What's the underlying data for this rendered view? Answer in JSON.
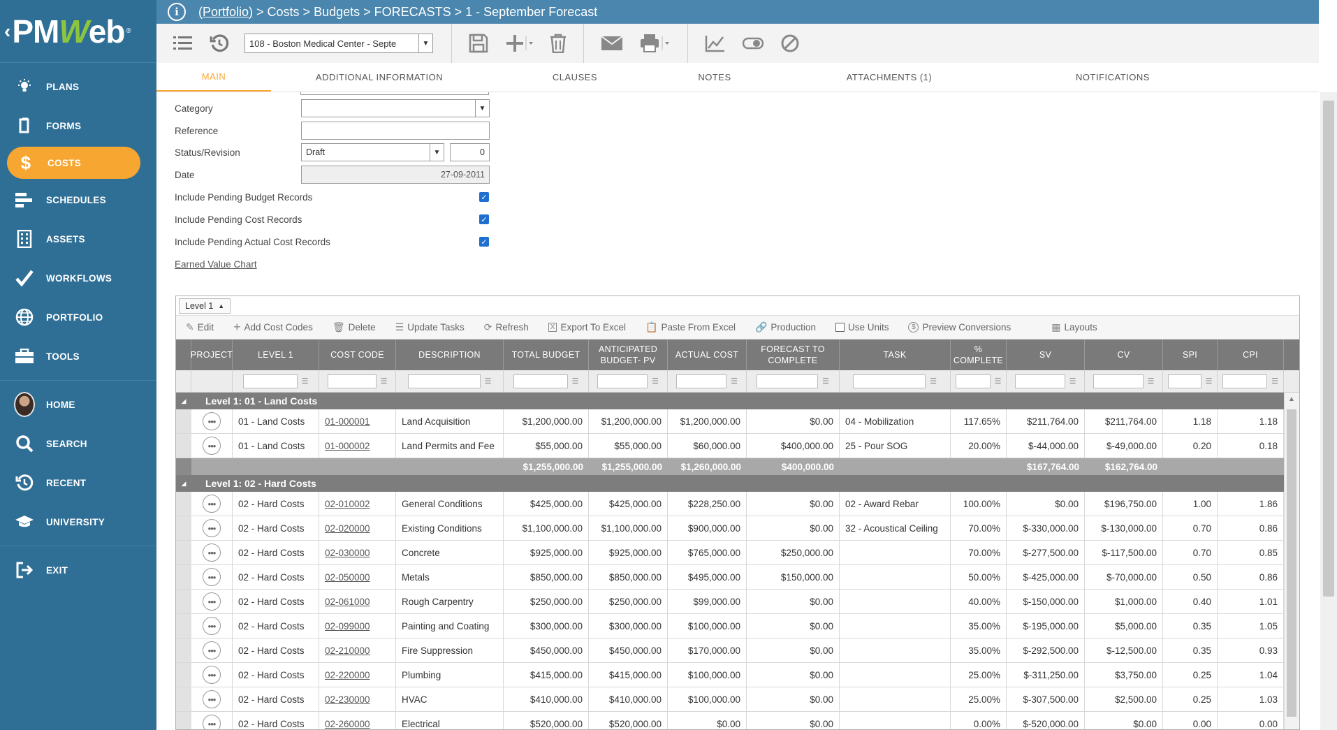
{
  "sidebar": {
    "logo": {
      "prefix": "PM",
      "w": "W",
      "suffix": "eb",
      "reg": "®"
    },
    "items": [
      {
        "label": "PLANS",
        "icon": "bulb-icon"
      },
      {
        "label": "FORMS",
        "icon": "document-icon"
      },
      {
        "label": "COSTS",
        "icon": "dollar-icon",
        "active": true
      },
      {
        "label": "SCHEDULES",
        "icon": "gantt-icon"
      },
      {
        "label": "ASSETS",
        "icon": "building-icon"
      },
      {
        "label": "WORKFLOWS",
        "icon": "checkmark-icon"
      },
      {
        "label": "PORTFOLIO",
        "icon": "globe-icon"
      },
      {
        "label": "TOOLS",
        "icon": "toolbox-icon"
      },
      {
        "label": "HOME",
        "icon": "avatar"
      },
      {
        "label": "SEARCH",
        "icon": "search-icon"
      },
      {
        "label": "RECENT",
        "icon": "history-icon"
      },
      {
        "label": "UNIVERSITY",
        "icon": "graduation-cap-icon"
      },
      {
        "label": "EXIT",
        "icon": "exit-icon"
      }
    ],
    "colors": {
      "bg": "#2f6f96",
      "active": "#f7a631"
    }
  },
  "breadcrumb": {
    "portfolio": "(Portfolio)",
    "rest": " > Costs > Budgets > FORECASTS > 1 - September Forecast"
  },
  "toolbar": {
    "project_select": "108 - Boston Medical Center - Septe"
  },
  "tabs": [
    {
      "label": "MAIN",
      "active": true
    },
    {
      "label": "ADDITIONAL INFORMATION"
    },
    {
      "label": "CLAUSES"
    },
    {
      "label": "NOTES"
    },
    {
      "label": "ATTACHMENTS (1)"
    },
    {
      "label": "NOTIFICATIONS"
    }
  ],
  "form": {
    "category_label": "Category",
    "category_value": "",
    "reference_label": "Reference",
    "reference_value": "",
    "status_label": "Status/Revision",
    "status_value": "Draft",
    "revision_value": "0",
    "date_label": "Date",
    "date_value": "27-09-2011",
    "pending_budget_label": "Include Pending Budget Records",
    "pending_cost_label": "Include Pending Cost Records",
    "pending_actual_label": "Include Pending Actual Cost Records",
    "earned_value_link": "Earned Value Chart"
  },
  "grid": {
    "level_selector": "Level 1",
    "tools": {
      "edit": "Edit",
      "add_cost_codes": "Add Cost Codes",
      "delete": "Delete",
      "update_tasks": "Update Tasks",
      "refresh": "Refresh",
      "export_excel": "Export To Excel",
      "paste_excel": "Paste From Excel",
      "production": "Production",
      "use_units": "Use Units",
      "preview_conversions": "Preview Conversions",
      "layouts": "Layouts"
    },
    "headers": {
      "project": "PROJECT",
      "level1": "LEVEL 1",
      "cost_code": "COST CODE",
      "description": "DESCRIPTION",
      "total_budget": "TOTAL BUDGET",
      "anticipated_1": "ANTICIPATED",
      "anticipated_2": "BUDGET- PV",
      "actual_cost": "ACTUAL COST",
      "forecast_1": "FORECAST TO",
      "forecast_2": "COMPLETE",
      "task": "TASK",
      "pct_1": "%",
      "pct_2": "COMPLETE",
      "sv": "SV",
      "cv": "CV",
      "spi": "SPI",
      "cpi": "CPI"
    },
    "group1": {
      "title": "Level 1: 01 - Land Costs",
      "rows": [
        {
          "level": "01 - Land Costs",
          "code": "01-000001",
          "desc": "Land Acquisition",
          "budget": "$1,200,000.00",
          "pv": "$1,200,000.00",
          "actual": "$1,200,000.00",
          "forecast": "$0.00",
          "task": "04 - Mobilization",
          "pct": "117.65%",
          "sv": "$211,764.00",
          "cv": "$211,764.00",
          "spi": "1.18",
          "cpi": "1.18"
        },
        {
          "level": "01 - Land Costs",
          "code": "01-000002",
          "desc": "Land Permits and Fee",
          "budget": "$55,000.00",
          "pv": "$55,000.00",
          "actual": "$60,000.00",
          "forecast": "$400,000.00",
          "task": "25 - Pour SOG",
          "pct": "20.00%",
          "sv": "$-44,000.00",
          "cv": "$-49,000.00",
          "spi": "0.20",
          "cpi": "0.18"
        }
      ],
      "subtotal": {
        "budget": "$1,255,000.00",
        "pv": "$1,255,000.00",
        "actual": "$1,260,000.00",
        "forecast": "$400,000.00",
        "sv": "$167,764.00",
        "cv": "$162,764.00"
      }
    },
    "group2": {
      "title": "Level 1: 02 - Hard Costs",
      "rows": [
        {
          "level": "02 - Hard Costs",
          "code": "02-010002",
          "desc": "General Conditions",
          "budget": "$425,000.00",
          "pv": "$425,000.00",
          "actual": "$228,250.00",
          "forecast": "$0.00",
          "task": "02 - Award Rebar",
          "pct": "100.00%",
          "sv": "$0.00",
          "cv": "$196,750.00",
          "spi": "1.00",
          "cpi": "1.86"
        },
        {
          "level": "02 - Hard Costs",
          "code": "02-020000",
          "desc": "Existing Conditions",
          "budget": "$1,100,000.00",
          "pv": "$1,100,000.00",
          "actual": "$900,000.00",
          "forecast": "$0.00",
          "task": "32 - Acoustical Ceiling",
          "pct": "70.00%",
          "sv": "$-330,000.00",
          "cv": "$-130,000.00",
          "spi": "0.70",
          "cpi": "0.86"
        },
        {
          "level": "02 - Hard Costs",
          "code": "02-030000",
          "desc": "Concrete",
          "budget": "$925,000.00",
          "pv": "$925,000.00",
          "actual": "$765,000.00",
          "forecast": "$250,000.00",
          "task": "",
          "pct": "70.00%",
          "sv": "$-277,500.00",
          "cv": "$-117,500.00",
          "spi": "0.70",
          "cpi": "0.85"
        },
        {
          "level": "02 - Hard Costs",
          "code": "02-050000",
          "desc": "Metals",
          "budget": "$850,000.00",
          "pv": "$850,000.00",
          "actual": "$495,000.00",
          "forecast": "$150,000.00",
          "task": "",
          "pct": "50.00%",
          "sv": "$-425,000.00",
          "cv": "$-70,000.00",
          "spi": "0.50",
          "cpi": "0.86"
        },
        {
          "level": "02 - Hard Costs",
          "code": "02-061000",
          "desc": "Rough Carpentry",
          "budget": "$250,000.00",
          "pv": "$250,000.00",
          "actual": "$99,000.00",
          "forecast": "$0.00",
          "task": "",
          "pct": "40.00%",
          "sv": "$-150,000.00",
          "cv": "$1,000.00",
          "spi": "0.40",
          "cpi": "1.01"
        },
        {
          "level": "02 - Hard Costs",
          "code": "02-099000",
          "desc": "Painting and Coating",
          "budget": "$300,000.00",
          "pv": "$300,000.00",
          "actual": "$100,000.00",
          "forecast": "$0.00",
          "task": "",
          "pct": "35.00%",
          "sv": "$-195,000.00",
          "cv": "$5,000.00",
          "spi": "0.35",
          "cpi": "1.05"
        },
        {
          "level": "02 - Hard Costs",
          "code": "02-210000",
          "desc": "Fire Suppression",
          "budget": "$450,000.00",
          "pv": "$450,000.00",
          "actual": "$170,000.00",
          "forecast": "$0.00",
          "task": "",
          "pct": "35.00%",
          "sv": "$-292,500.00",
          "cv": "$-12,500.00",
          "spi": "0.35",
          "cpi": "0.93"
        },
        {
          "level": "02 - Hard Costs",
          "code": "02-220000",
          "desc": "Plumbing",
          "budget": "$415,000.00",
          "pv": "$415,000.00",
          "actual": "$100,000.00",
          "forecast": "$0.00",
          "task": "",
          "pct": "25.00%",
          "sv": "$-311,250.00",
          "cv": "$3,750.00",
          "spi": "0.25",
          "cpi": "1.04"
        },
        {
          "level": "02 - Hard Costs",
          "code": "02-230000",
          "desc": "HVAC",
          "budget": "$410,000.00",
          "pv": "$410,000.00",
          "actual": "$100,000.00",
          "forecast": "$0.00",
          "task": "",
          "pct": "25.00%",
          "sv": "$-307,500.00",
          "cv": "$2,500.00",
          "spi": "0.25",
          "cpi": "1.03"
        },
        {
          "level": "02 - Hard Costs",
          "code": "02-260000",
          "desc": "Electrical",
          "budget": "$520,000.00",
          "pv": "$520,000.00",
          "actual": "$0.00",
          "forecast": "$0.00",
          "task": "",
          "pct": "0.00%",
          "sv": "$-520,000.00",
          "cv": "$0.00",
          "spi": "0.00",
          "cpi": "0.00"
        }
      ]
    }
  }
}
